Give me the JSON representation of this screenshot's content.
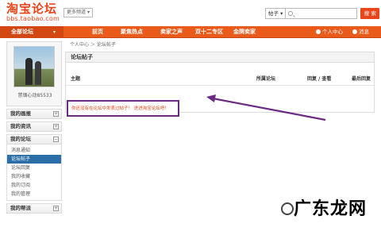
{
  "header": {
    "logo_title": "淘宝论坛",
    "logo_url": "bbs.taobao.com",
    "more_label": "更多频道",
    "search_type": "帖子",
    "search_button": "搜 索"
  },
  "nav": {
    "first": "全部论坛",
    "items": [
      "前页",
      "聚焦热点",
      "卖家之声",
      "双十二专区",
      "金牌卖家"
    ],
    "right_items": [
      "个人中心",
      "消息"
    ]
  },
  "sidebar": {
    "username": "禁锢心动85533",
    "sections": [
      {
        "label": "我的画报"
      },
      {
        "label": "我的资讯"
      },
      {
        "label": "我的论坛"
      }
    ],
    "forum_items": [
      "消息通知",
      "论坛帖子",
      "论坛回复",
      "我的收藏",
      "我的订阅",
      "我的管理"
    ],
    "bottom_section": "我的帮派"
  },
  "main": {
    "breadcrumb": "个人中心 ＞ 论坛帖子",
    "panel_title": "论坛帖子",
    "columns": [
      "主题",
      "所属论坛",
      "回复 / 查看",
      "最后回复"
    ],
    "empty_message": "你还没有在论坛中发表过帖子！ 进进淘宝论坛吧！"
  },
  "watermark": "广东龙网",
  "colors": {
    "brand": "#ea5a1a",
    "active": "#2c6ea8",
    "highlight": "#6b2b82"
  }
}
